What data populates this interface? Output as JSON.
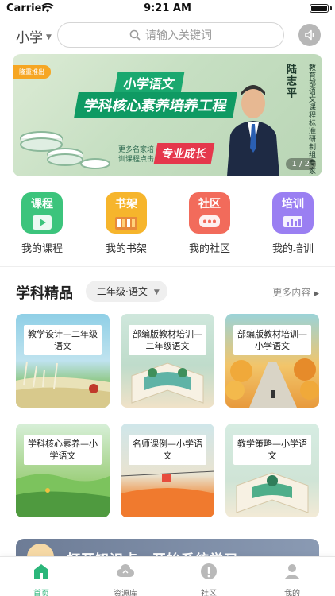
{
  "status_bar": {
    "carrier": "Carrier",
    "time": "9:21 AM"
  },
  "header": {
    "level": "小学",
    "search_placeholder": "请输入关键词"
  },
  "banner": {
    "tag": "隆重推出",
    "title_line1": "小学语文",
    "title_line2": "学科核心素养培养工程",
    "subtitle": "更多名家培训课程点击",
    "badge": "专业成长",
    "speaker_name": "陆志平",
    "speaker_desc": "教育部语文课程标准研制组专家",
    "pager": "1 / 2"
  },
  "categories": [
    {
      "icon_text": "课程",
      "label": "我的课程",
      "color": "#3cc47c",
      "icon": "play-icon"
    },
    {
      "icon_text": "书架",
      "label": "我的书架",
      "color": "#f6b52c",
      "icon": "bookshelf-icon"
    },
    {
      "icon_text": "社区",
      "label": "我的社区",
      "color": "#f26b5b",
      "icon": "chat-icon"
    },
    {
      "icon_text": "培训",
      "label": "我的培训",
      "color": "#9a7ff2",
      "icon": "board-icon"
    }
  ],
  "section": {
    "title": "学科精品",
    "grade": "二年级·语文",
    "more": "更多内容"
  },
  "courses": [
    {
      "title": "教学设计—二年级语文"
    },
    {
      "title": "部编版教材培训—二年级语文"
    },
    {
      "title": "部编版教材培训—小学语文"
    },
    {
      "title": "学科核心素养—小学语文"
    },
    {
      "title": "名师课例—小学语文"
    },
    {
      "title": "教学策略—小学语文"
    }
  ],
  "continue_strip": {
    "text": "打开知识点，开始系统学习"
  },
  "tabs": [
    {
      "label": "首页",
      "icon": "home-icon",
      "active": true
    },
    {
      "label": "资源库",
      "icon": "cloud-icon",
      "active": false
    },
    {
      "label": "社区",
      "icon": "community-icon",
      "active": false
    },
    {
      "label": "我的",
      "icon": "person-icon",
      "active": false
    }
  ],
  "colors": {
    "accent": "#2bb67a",
    "banner_green": "#0f9a63",
    "badge_red": "#e5374c"
  }
}
